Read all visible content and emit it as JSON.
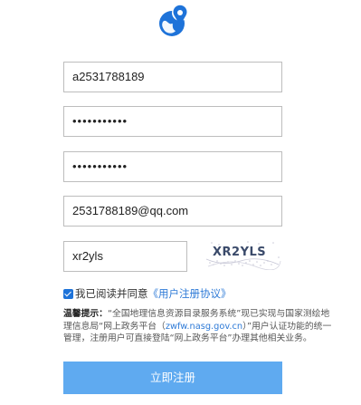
{
  "logo": {
    "icon": "globe-location-pin-icon",
    "color": "#1e73d9"
  },
  "form": {
    "username": "a2531788189",
    "password_mask": "•••••••••••",
    "confirm_password_mask": "•••••••••••",
    "email": "2531788189@qq.com",
    "captcha_input": "xr2yls",
    "captcha_image_text": "XR2YLS"
  },
  "agreement": {
    "checked": true,
    "prefix": "我已阅读并同意",
    "link_label": "《用户注册协议》"
  },
  "notice": {
    "label": "温馨提示：",
    "text_1": "“全国地理信息资源目录服务系统”现已实现与国家测绘地理信息局“网上政务平台（",
    "url": "zwfw.nasg.gov.cn",
    "text_2": "）”用户认证功能的统一管理，注册用户可直接登陆“网上政务平台”办理其他相关业务。"
  },
  "submit": {
    "label": "立即注册",
    "color": "#5faaf0"
  }
}
